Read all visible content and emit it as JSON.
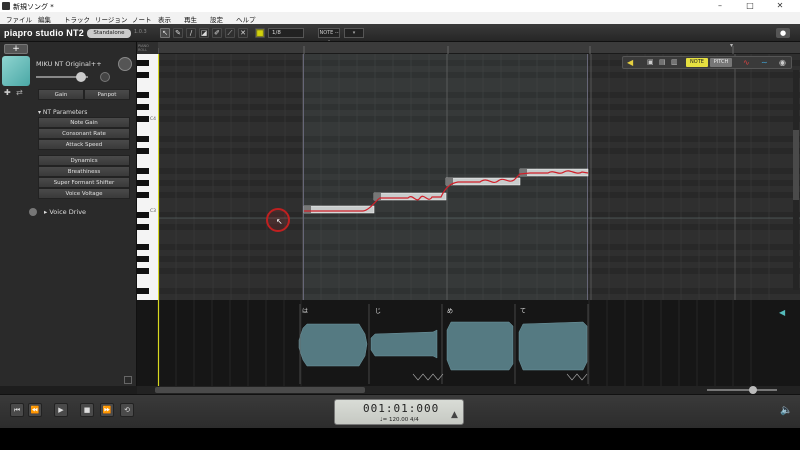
{
  "window": {
    "title": "新規ソング *",
    "controls": [
      "–",
      "□",
      "✕"
    ]
  },
  "menu": [
    "ファイル",
    "編集",
    "トラック",
    "リージョン",
    "ノート",
    "表示",
    "再生",
    "設定",
    "ヘルプ"
  ],
  "toolbar": {
    "logo": "piapro studio NT2",
    "mode": "Standalone",
    "version": "1.0.3",
    "snap": "1/8",
    "note_plus": "NOTE ---",
    "tools": [
      "pointer-tool",
      "pencil-tool",
      "line-tool",
      "eraser-tool",
      "brush-tool",
      "knife-tool",
      "cross-tool"
    ]
  },
  "track": {
    "singer": "MIKU NT Original++",
    "gain_label": "Gain",
    "panpot_label": "Panpot",
    "nt_params_label": "NT Parameters",
    "params": [
      "Note Gain",
      "Consonant Rate",
      "Attack Speed"
    ],
    "effects": [
      "Dynamics",
      "Breathiness",
      "Super Formant Shifter",
      "Voice Voltage"
    ],
    "voice_drive": "Voice Drive"
  },
  "piano": {
    "octaves": [
      "C4",
      "C3"
    ],
    "header": "PIANO ROLL"
  },
  "notes": [
    {
      "lyric": "は"
    },
    {
      "lyric": "じ"
    },
    {
      "lyric": "め"
    },
    {
      "lyric": "て"
    }
  ],
  "view_tabs": {
    "note": "NOTE",
    "pitch": "PITCH"
  },
  "transport": {
    "time": "001:01:000",
    "tempo": "♩= 120.00",
    "signature": "4/4"
  }
}
